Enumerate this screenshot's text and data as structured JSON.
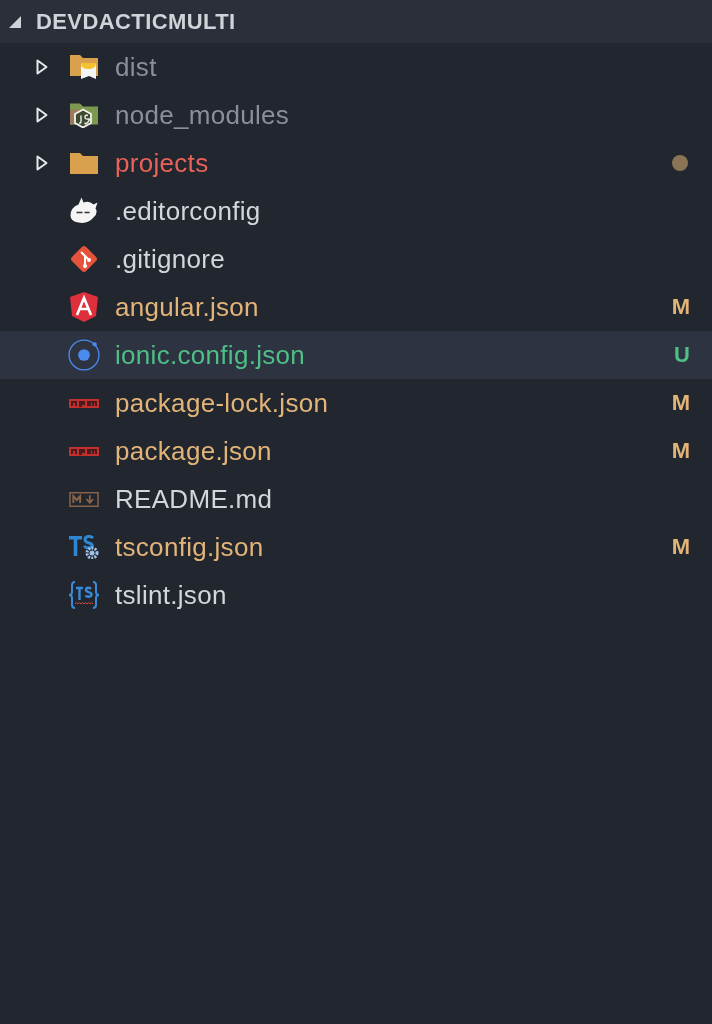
{
  "explorer": {
    "title": "DEVDACTICMULTI",
    "expanded": true,
    "items": [
      {
        "name": "dist",
        "kind": "folder-dist",
        "expanded": false,
        "color": "#8a8f98",
        "selected": false
      },
      {
        "name": "node_modules",
        "kind": "folder-node",
        "expanded": false,
        "color": "#8a8f98",
        "selected": false
      },
      {
        "name": "projects",
        "kind": "folder",
        "expanded": false,
        "color": "#e8625a",
        "dot": {
          "color": "#8b7355"
        },
        "selected": false
      },
      {
        "name": ".editorconfig",
        "kind": "editorconfig",
        "color": "#d3d6db",
        "selected": false
      },
      {
        "name": ".gitignore",
        "kind": "git",
        "color": "#d3d6db",
        "selected": false
      },
      {
        "name": "angular.json",
        "kind": "angular",
        "color": "#e2b477",
        "badge": "M",
        "selected": false
      },
      {
        "name": "ionic.config.json",
        "kind": "ionic",
        "color": "#4fbf87",
        "badge": "U",
        "selected": true
      },
      {
        "name": "package-lock.json",
        "kind": "npm",
        "color": "#e2b477",
        "badge": "M",
        "selected": false
      },
      {
        "name": "package.json",
        "kind": "npm",
        "color": "#e2b477",
        "badge": "M",
        "selected": false
      },
      {
        "name": "README.md",
        "kind": "markdown",
        "color": "#d3d6db",
        "selected": false
      },
      {
        "name": "tsconfig.json",
        "kind": "ts-config",
        "color": "#e2b477",
        "badge": "M",
        "selected": false
      },
      {
        "name": "tslint.json",
        "kind": "tslint",
        "color": "#d3d6db",
        "selected": false
      }
    ]
  }
}
